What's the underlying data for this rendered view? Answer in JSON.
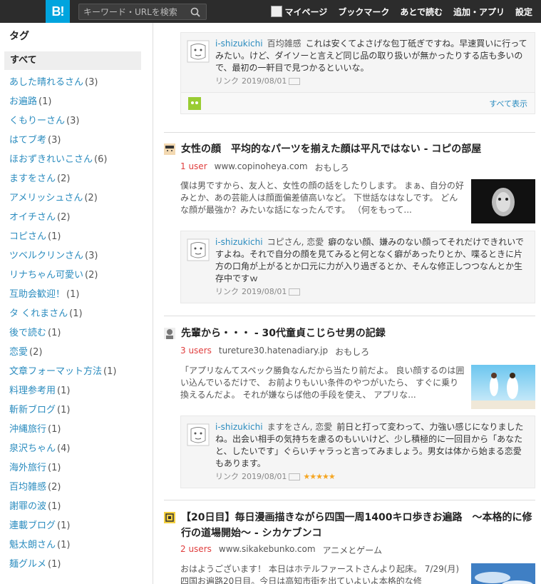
{
  "header": {
    "logo": "B!",
    "search_placeholder": "キーワード・URLを検索",
    "nav": [
      "マイページ",
      "ブックマーク",
      "あとで読む",
      "追加・アプリ",
      "設定"
    ]
  },
  "sidebar": {
    "heading": "タグ",
    "all_label": "すべて",
    "tags": [
      {
        "name": "あした晴れるさん",
        "count": "(3)"
      },
      {
        "name": "お遍路",
        "count": "(1)"
      },
      {
        "name": "くもりーさん",
        "count": "(3)"
      },
      {
        "name": "はてブ考",
        "count": "(3)"
      },
      {
        "name": "ほおずきれいこさん",
        "count": "(6)"
      },
      {
        "name": "ますをさん",
        "count": "(2)"
      },
      {
        "name": "アメリッシュさん",
        "count": "(2)"
      },
      {
        "name": "オイチさん",
        "count": "(2)"
      },
      {
        "name": "コピさん",
        "count": "(1)"
      },
      {
        "name": "ツベルクリンさん",
        "count": "(3)"
      },
      {
        "name": "リナちゃん可愛い",
        "count": "(2)"
      },
      {
        "name": "互助会歓迎！",
        "count": "(1)"
      },
      {
        "name": "タ くれまさん",
        "count": "(1)"
      },
      {
        "name": "後で読む",
        "count": "(1)"
      },
      {
        "name": "恋愛",
        "count": "(2)"
      },
      {
        "name": "文章フォーマット方法",
        "count": "(1)"
      },
      {
        "name": "料理参考用",
        "count": "(1)"
      },
      {
        "name": "斬新ブログ",
        "count": "(1)"
      },
      {
        "name": "沖縄旅行",
        "count": "(1)"
      },
      {
        "name": "泉沢ちゃん",
        "count": "(4)"
      },
      {
        "name": "海外旅行",
        "count": "(1)"
      },
      {
        "name": "百均雑感",
        "count": "(2)"
      },
      {
        "name": "謝罪の波",
        "count": "(1)"
      },
      {
        "name": "連載ブログ",
        "count": "(1)"
      },
      {
        "name": "魁太朗さん",
        "count": "(1)"
      },
      {
        "name": "麺グルメ",
        "count": "(1)"
      }
    ]
  },
  "entries": [
    {
      "comment": {
        "user": "i-shizukichi",
        "tags": "百均雑感",
        "text": "これは安くてよさげな包丁砥ぎですね。早速買いに行ってみたい。けど、ダイソーと言えど同じ品の取り扱いが無かったりする店も多いので、最初の一軒目で見つかるといいな。",
        "link": "リンク",
        "date": "2019/08/01"
      },
      "show_all": "すべて表示"
    },
    {
      "title": "女性の顔　平均的なパーツを揃えた顔は平凡ではない - コピの部屋",
      "users": "1 user",
      "domain": "www.copinoheya.com",
      "category": "おもしろ",
      "excerpt": "僕は男ですから、友人と、女性の顔の話をしたりします。 まぁ、自分の好みとか、あの芸能人は顔面偏差値高いなど。 下世話なはなしです。 どんな顔が最強か？みたいな話になったんです。 （何をもって...",
      "comment": {
        "user": "i-shizukichi",
        "tags": "コピさん, 恋愛",
        "text": "癖のない顔、嫌みのない顔ってそれだけできれいですよね。それで自分の顔を見てみると何となく癖があったりとか、喋るときに片方の口角が上がるとか口元に力が入り過ぎるとか、そんな修正しつつなんとか生存中ですｗ",
        "link": "リンク",
        "date": "2019/08/01"
      }
    },
    {
      "title": "先輩から・・・ - 30代童貞こじらせ男の記録",
      "users": "3 users",
      "domain": "tureture30.hatenadiary.jp",
      "category": "おもしろ",
      "excerpt": "「アプリなんてスペック勝負なんだから当たり前だよ。 良い顔するのは囲い込んでいるだけで、 お前よりもいい条件のやつがいたら、 すぐに乗り換えるんだよ。 それが嫌ならば他の手段を使え、 アプリな...",
      "comment": {
        "user": "i-shizukichi",
        "tags": "ますをさん, 恋愛",
        "text": "前日と打って変わって、力強い感じになりましたね。出会い相手の気持ちを慮るのもいいけど、少し積極的に一回目から「あなたと、したいです」ぐらいチャラっと言ってみましょう。男女は体から始まる恋愛もあります。",
        "link": "リンク",
        "date": "2019/08/01",
        "stars": "★★★★★"
      }
    },
    {
      "title": "【20日目】毎日漫画描きながら四国一周1400キロ歩きお遍路　～本格的に修行の道場開始～ - シカケブンコ",
      "users": "2 users",
      "domain": "www.sikakebunko.com",
      "category": "アニメとゲーム",
      "excerpt": "おはようございます！ 本日はホテルファーストさんより起床。 7/29(月)　四国お遍路20日目。今日は高知市街を出ていよいよ本格的な修"
    }
  ],
  "colors": {
    "header_bg": "#2c2c2c",
    "logo_bg": "#00a4de",
    "link": "#2b8cbf",
    "users": "#e03e3e"
  }
}
